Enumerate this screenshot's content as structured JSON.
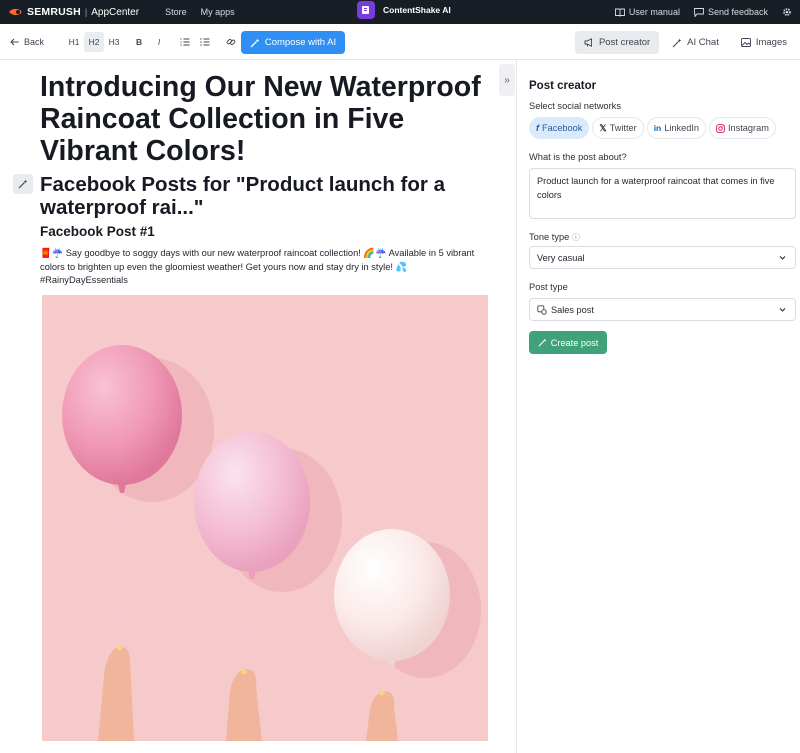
{
  "topbar": {
    "brand": "SEMRUSH",
    "brand_app": "AppCenter",
    "nav": [
      "Store",
      "My apps"
    ],
    "app_title": "ContentShake AI",
    "user_manual": "User manual",
    "send_feedback": "Send feedback"
  },
  "toolbar": {
    "back": "Back",
    "h1": "H1",
    "h2": "H2",
    "h3": "H3",
    "bold": "B",
    "italic": "I",
    "clear_format": "Tx",
    "compose": "Compose with AI",
    "tabs": {
      "post_creator": "Post creator",
      "ai_chat": "AI Chat",
      "images": "Images"
    }
  },
  "editor": {
    "title": "Introducing Our New Waterproof Raincoat Collection in Five Vibrant Colors!",
    "subtitle": "Facebook Posts for \"Product launch for a waterproof rai...\"",
    "post_heading": "Facebook Post #1",
    "post_body": "🧧☔ Say goodbye to soggy days with our new waterproof raincoat collection! 🌈☔ Available in 5 vibrant colors to brighten up even the gloomiest weather! Get yours now and stay dry in style! 💦 #RainyDayEssentials"
  },
  "panel": {
    "title": "Post creator",
    "networks_label": "Select social networks",
    "networks": [
      "Facebook",
      "Twitter",
      "LinkedIn",
      "Instagram"
    ],
    "about_label": "What is the post about?",
    "about_value": "Product launch for a waterproof raincoat that comes in five colors",
    "tone_label": "Tone type",
    "tone_value": "Very casual",
    "post_type_label": "Post type",
    "post_type_value": "Sales post",
    "create_button": "Create post"
  },
  "colors": {
    "topbar_bg": "#181e26",
    "compose_blue": "#2f8ff2",
    "create_green": "#3fa27a",
    "active_chip": "#dbeafb",
    "image_bg": "#f6c9cb"
  }
}
